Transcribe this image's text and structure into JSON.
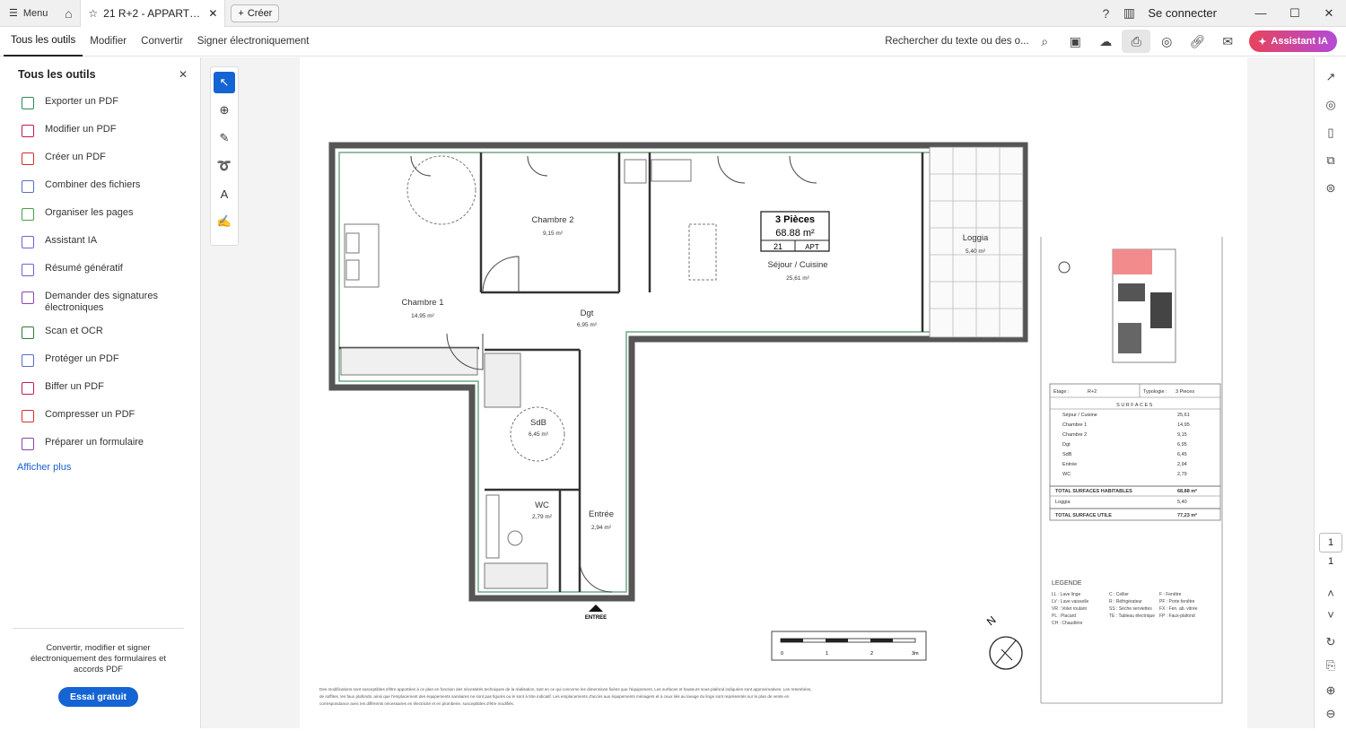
{
  "titlebar": {
    "menu_label": "Menu",
    "tab_title": "21 R+2 - APPARTE...",
    "create_label": "Créer",
    "connect_label": "Se connecter"
  },
  "toolbar": {
    "tabs": [
      "Tous les outils",
      "Modifier",
      "Convertir",
      "Signer électroniquement"
    ],
    "search_placeholder": "Rechercher du texte ou des o...",
    "ai_label": "Assistant IA"
  },
  "left_panel": {
    "title": "Tous les outils",
    "items": [
      {
        "label": "Exporter un PDF",
        "color": "#2e8b57"
      },
      {
        "label": "Modifier un PDF",
        "color": "#c2185b"
      },
      {
        "label": "Créer un PDF",
        "color": "#d32f2f"
      },
      {
        "label": "Combiner des fichiers",
        "color": "#5c6bc0"
      },
      {
        "label": "Organiser les pages",
        "color": "#43a047"
      },
      {
        "label": "Assistant IA",
        "color": "#7b5cd6"
      },
      {
        "label": "Résumé génératif",
        "color": "#7b5cd6"
      },
      {
        "label": "Demander des signatures électroniques",
        "color": "#8e44ad"
      },
      {
        "label": "Scan et OCR",
        "color": "#2e7d32"
      },
      {
        "label": "Protéger un PDF",
        "color": "#5c6bc0"
      },
      {
        "label": "Biffer un PDF",
        "color": "#c2185b"
      },
      {
        "label": "Compresser un PDF",
        "color": "#d32f2f"
      },
      {
        "label": "Préparer un formulaire",
        "color": "#8e44ad"
      }
    ],
    "more_label": "Afficher plus",
    "promo_text": "Convertir, modifier et signer électroniquement des formulaires et accords PDF",
    "trial_label": "Essai gratuit"
  },
  "page_number": "1",
  "page_total": "1",
  "plan": {
    "rooms": {
      "chambre2": {
        "name": "Chambre 2",
        "area": "9,15 m²"
      },
      "chambre1": {
        "name": "Chambre 1",
        "area": "14,95 m²"
      },
      "dgt": {
        "name": "Dgt",
        "area": "6,95 m²"
      },
      "sejour": {
        "name": "Séjour / Cuisine",
        "area": "25,61 m²"
      },
      "loggia": {
        "name": "Loggia",
        "area": "5,40 m²"
      },
      "sdb": {
        "name": "SdB",
        "area": "6,45 m²"
      },
      "wc": {
        "name": "WC",
        "area": "2,79 m²"
      },
      "entree": {
        "name": "Entrée",
        "area": "2,94 m²"
      }
    },
    "badge": {
      "pieces": "3 Pièces",
      "total": "68.88 m²",
      "lot": "21",
      "type": "APT"
    },
    "entry_label": "ENTREE",
    "north_label": "N",
    "scale_labels": [
      "0",
      "1",
      "2",
      "3m"
    ],
    "info": {
      "etage_label": "Etage :",
      "etage": "R+2",
      "typo_label": "Typologie :",
      "typo": "3 Pieces",
      "surfaces_title": "SURFACES",
      "rows": [
        {
          "name": "Séjour / Cuisine",
          "value": "25,61"
        },
        {
          "name": "Chambre 1",
          "value": "14,95"
        },
        {
          "name": "Chambre 2",
          "value": "9,15"
        },
        {
          "name": "Dgt",
          "value": "6,95"
        },
        {
          "name": "SdB",
          "value": "6,45"
        },
        {
          "name": "Entrée",
          "value": "2,94"
        },
        {
          "name": "WC",
          "value": "2,79"
        }
      ],
      "total_hab_label": "TOTAL SURFACES HABITABLES",
      "total_hab": "68,88 m²",
      "loggia_label": "Loggia",
      "loggia": "5,40",
      "total_util_label": "TOTAL SURFACE UTILE",
      "total_util": "77,23 m²"
    },
    "legend_title": "LEGENDE",
    "legend_cols": [
      [
        "LL : Lave linge",
        "LV : Lave vaisselle",
        "VR : Volet roulant",
        "PL : Placard",
        "CH : Chaudière"
      ],
      [
        "C : Cellier",
        "R : Réfrigérateur",
        "SS : Sèche serviettes",
        "TE : Tableau électrique"
      ],
      [
        "F : Fenêtre",
        "PF : Porte fenêtre",
        "FX : Fen. ab. vitrée",
        "FP : Faux-plafond"
      ]
    ],
    "disclaimer": [
      "Des modifications sont susceptibles d'être apportées à ce plan en fonction des nécessités techniques de la réalisation, tant en ce qui concerne les dimensions fixées que l'équipement. Les surfaces et hauteurs sous-plafond indiquées sont approximatives. Les retombées,",
      "de soffites, les faux plafonds, ainsi que l'emplacement des équipements sanitaires ne sont pas figurés ou le sont à titre indicatif. Les emplacements d'accès aux équipements ménagers et à ceux liés au lavage du linge sont représentés sur le plan de vente en",
      "correspondance avec les différents nécessaires en électricité et en plomberie, susceptibles d'être modifiés."
    ]
  }
}
